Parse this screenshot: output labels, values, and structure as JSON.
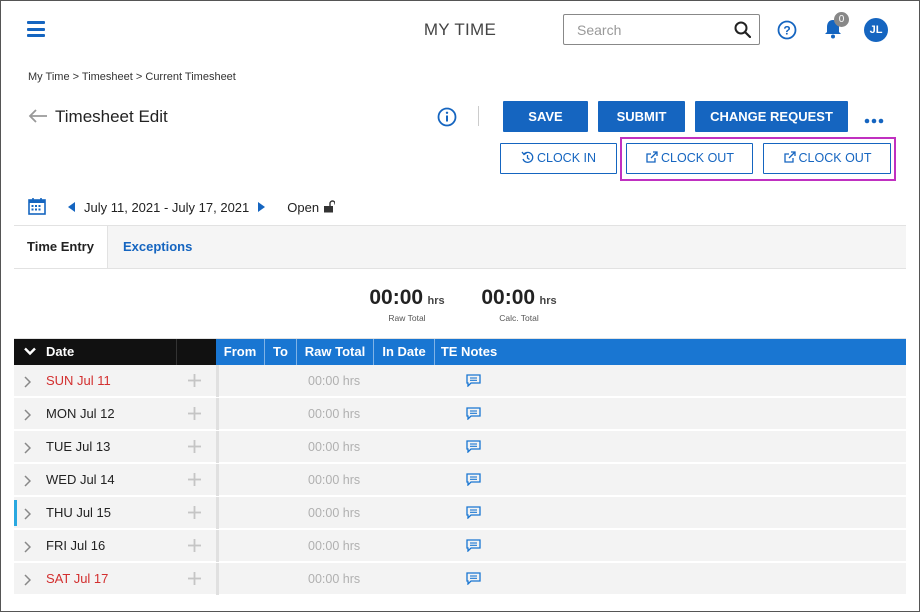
{
  "header": {
    "title": "MY TIME",
    "search_placeholder": "Search",
    "notification_count": "0",
    "avatar_initials": "JL"
  },
  "breadcrumb": "My Time > Timesheet > Current Timesheet",
  "page": {
    "title": "Timesheet Edit"
  },
  "actions": {
    "save": "SAVE",
    "submit": "SUBMIT",
    "change_request": "CHANGE REQUEST",
    "clock_in": "CLOCK IN",
    "clock_out_1": "CLOCK OUT",
    "clock_out_2": "CLOCK OUT"
  },
  "period": {
    "range": "July 11, 2021 - July 17, 2021",
    "status": "Open"
  },
  "tabs": [
    {
      "label": "Time Entry",
      "active": true
    },
    {
      "label": "Exceptions",
      "active": false
    }
  ],
  "totals": {
    "raw_value": "00:00",
    "raw_unit": "hrs",
    "raw_caption": "Raw Total",
    "calc_value": "00:00",
    "calc_unit": "hrs",
    "calc_caption": "Calc. Total"
  },
  "table": {
    "columns": {
      "date": "Date",
      "from": "From",
      "to": "To",
      "raw_total": "Raw Total",
      "in_date": "In Date",
      "te_notes": "TE Notes"
    },
    "rows": [
      {
        "day": "SUN Jul 11",
        "raw": "00:00 hrs",
        "weekend": true
      },
      {
        "day": "MON Jul 12",
        "raw": "00:00 hrs",
        "weekend": false
      },
      {
        "day": "TUE Jul 13",
        "raw": "00:00 hrs",
        "weekend": false
      },
      {
        "day": "WED Jul 14",
        "raw": "00:00 hrs",
        "weekend": false
      },
      {
        "day": "THU Jul 15",
        "raw": "00:00 hrs",
        "weekend": false,
        "current": true
      },
      {
        "day": "FRI Jul 16",
        "raw": "00:00 hrs",
        "weekend": false
      },
      {
        "day": "SAT Jul 17",
        "raw": "00:00 hrs",
        "weekend": true
      }
    ]
  },
  "colors": {
    "primary": "#1565c0",
    "header_blue": "#1976d2",
    "weekend_red": "#d32f2f",
    "highlight": "#c030c0",
    "current_day_indicator": "#29a8e0"
  }
}
